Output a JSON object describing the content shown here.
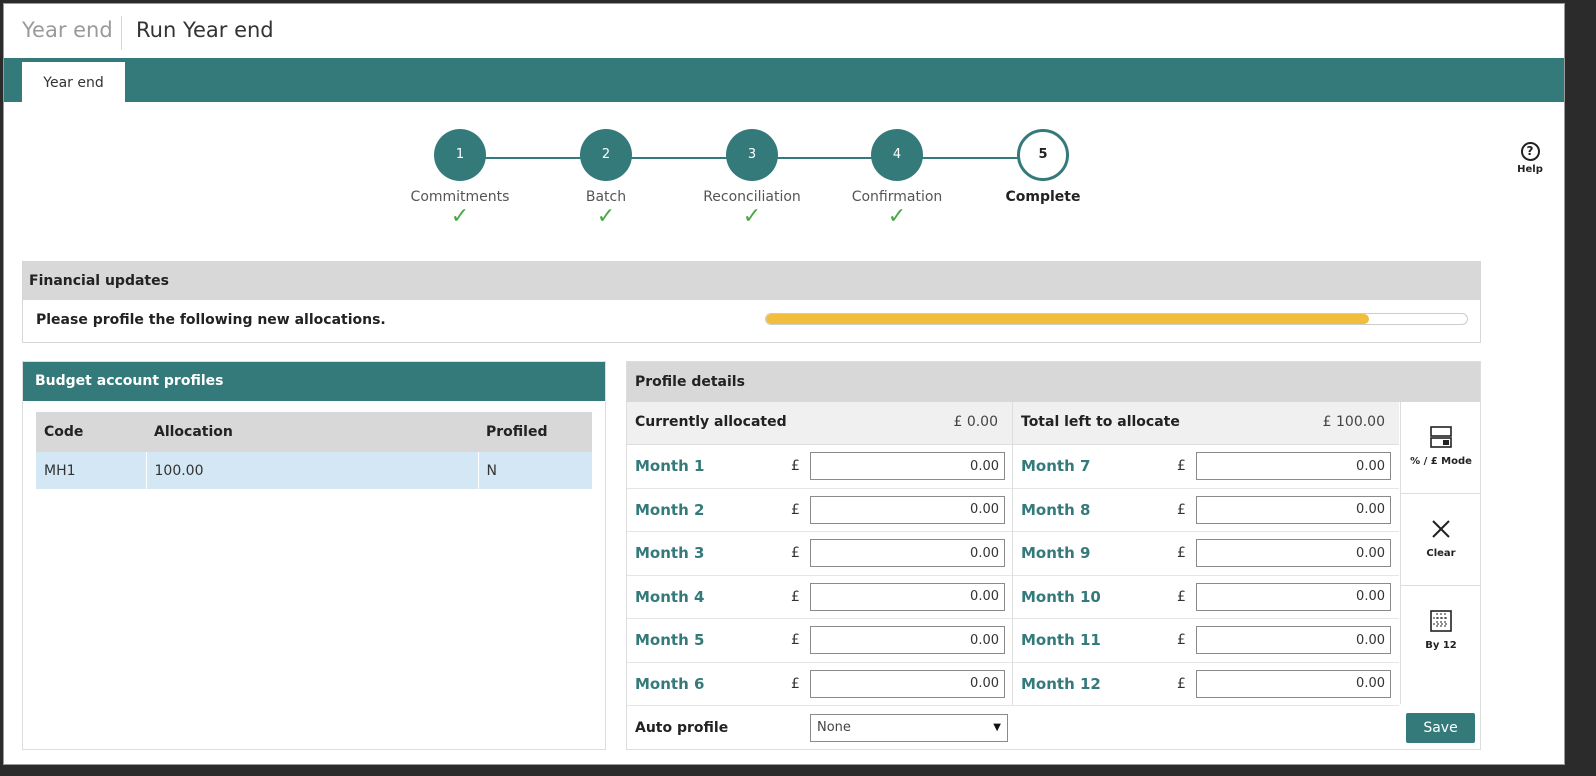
{
  "breadcrumb": {
    "parent": "Year end",
    "current": "Run Year end"
  },
  "tabs": [
    {
      "label": "Year end"
    }
  ],
  "help": {
    "label": "Help",
    "glyph": "?"
  },
  "steps": [
    {
      "number": "1",
      "label": "Commitments",
      "done": true
    },
    {
      "number": "2",
      "label": "Batch",
      "done": true
    },
    {
      "number": "3",
      "label": "Reconciliation",
      "done": true
    },
    {
      "number": "4",
      "label": "Confirmation",
      "done": true
    },
    {
      "number": "5",
      "label": "Complete",
      "done": false,
      "active": true
    }
  ],
  "check_glyph": "✓",
  "financial_updates": {
    "title": "Financial updates",
    "message": "Please profile the following new allocations.",
    "progress": 0.86,
    "progress_color": "#f0bd3c"
  },
  "budget_profiles": {
    "title": "Budget account profiles",
    "columns": [
      "Code",
      "Allocation",
      "Profiled"
    ],
    "rows": [
      {
        "code": "MH1",
        "allocation": "100.00",
        "profiled": "N"
      }
    ]
  },
  "profile_details": {
    "title": "Profile details",
    "currently_allocated": {
      "label": "Currently allocated",
      "value": "£ 0.00"
    },
    "total_left": {
      "label": "Total left to allocate",
      "value": "£ 100.00"
    },
    "currency_symbol": "£",
    "months": [
      {
        "label": "Month 1",
        "value": "0.00"
      },
      {
        "label": "Month 2",
        "value": "0.00"
      },
      {
        "label": "Month 3",
        "value": "0.00"
      },
      {
        "label": "Month 4",
        "value": "0.00"
      },
      {
        "label": "Month 5",
        "value": "0.00"
      },
      {
        "label": "Month 6",
        "value": "0.00"
      },
      {
        "label": "Month 7",
        "value": "0.00"
      },
      {
        "label": "Month 8",
        "value": "0.00"
      },
      {
        "label": "Month 9",
        "value": "0.00"
      },
      {
        "label": "Month 10",
        "value": "0.00"
      },
      {
        "label": "Month 11",
        "value": "0.00"
      },
      {
        "label": "Month 12",
        "value": "0.00"
      }
    ],
    "auto_profile": {
      "label": "Auto profile",
      "selected": "None",
      "caret": "▼"
    },
    "save_label": "Save",
    "tools": [
      {
        "label": "% / £ Mode",
        "icon": "toggle-mode-icon"
      },
      {
        "label": "Clear",
        "icon": "close-icon"
      },
      {
        "label": "By 12",
        "icon": "calendar-grid-icon"
      }
    ]
  },
  "colors": {
    "teal": "#357a7b",
    "check": "#4aa848",
    "highlight_row": "#d3e8f4"
  }
}
